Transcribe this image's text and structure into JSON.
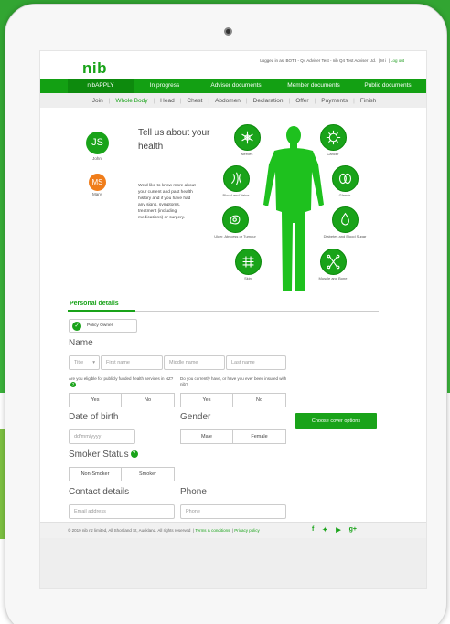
{
  "header": {
    "logo": "nib",
    "logged_in": "Logged in as: BOT3 - Q4 Adviser Test - nib Q4 Test Adviser Ltd.",
    "lang": "M i",
    "logout": "Log out"
  },
  "nav": {
    "items": [
      {
        "label": "nibAPPLY"
      },
      {
        "label": "In progress"
      },
      {
        "label": "Adviser documents"
      },
      {
        "label": "Member documents"
      },
      {
        "label": "Public documents"
      }
    ]
  },
  "subnav": {
    "items": [
      {
        "label": "Join"
      },
      {
        "label": "Whole Body"
      },
      {
        "label": "Head"
      },
      {
        "label": "Chest"
      },
      {
        "label": "Abdomen"
      },
      {
        "label": "Declaration"
      },
      {
        "label": "Offer"
      },
      {
        "label": "Payments"
      },
      {
        "label": "Finish"
      }
    ]
  },
  "members": [
    {
      "initials": "JS",
      "name": "John",
      "color": "#19a319"
    },
    {
      "initials": "MS",
      "name": "Mary",
      "color": "#f07d1a"
    }
  ],
  "health": {
    "title": "Tell us about your health",
    "description": "We'd like to know more about your current and past health history and if you have had any signs, symptoms, treatment (including medications) or surgery."
  },
  "categories": [
    {
      "label": "Nerves",
      "icon": "nerves-icon"
    },
    {
      "label": "Cancer",
      "icon": "cancer-icon"
    },
    {
      "label": "Blood and Veins",
      "icon": "blood-veins-icon"
    },
    {
      "label": "Glands",
      "icon": "glands-icon"
    },
    {
      "label": "Ulcer, Abscess or Tumour",
      "icon": "ulcer-icon"
    },
    {
      "label": "Diabetes and Blood Sugar",
      "icon": "diabetes-icon"
    },
    {
      "label": "Skin",
      "icon": "skin-icon"
    },
    {
      "label": "Muscle and Bone",
      "icon": "muscle-bone-icon"
    }
  ],
  "personal": {
    "tab": "Personal details",
    "policy_owner": "Policy Owner",
    "name_heading": "Name",
    "title_placeholder": "Title",
    "first_placeholder": "First name",
    "middle_placeholder": "Middle name",
    "last_placeholder": "Last name",
    "q_public": "Are you eligible for publicly funded health services in NZ?",
    "q_insured": "Do you currently have, or have you ever been insured with nib?",
    "yes": "Yes",
    "no": "No",
    "dob_heading": "Date of birth",
    "dob_placeholder": "dd/mm/yyyy",
    "gender_heading": "Gender",
    "male": "Male",
    "female": "Female",
    "smoker_heading": "Smoker Status",
    "non_smoker": "Non-Smoker",
    "smoker": "Smoker",
    "contact_heading": "Contact details",
    "email_placeholder": "Email address",
    "phone_heading": "Phone",
    "phone_placeholder": "Phone",
    "cta": "Choose cover options"
  },
  "footer": {
    "copyright": "© 2019 nib nz limited, All Shortland St, Auckland. All rights reserved",
    "terms": "Terms & conditions",
    "privacy": "Privacy policy"
  },
  "colors": {
    "brand": "#19a319",
    "accent_orange": "#f07d1a"
  }
}
